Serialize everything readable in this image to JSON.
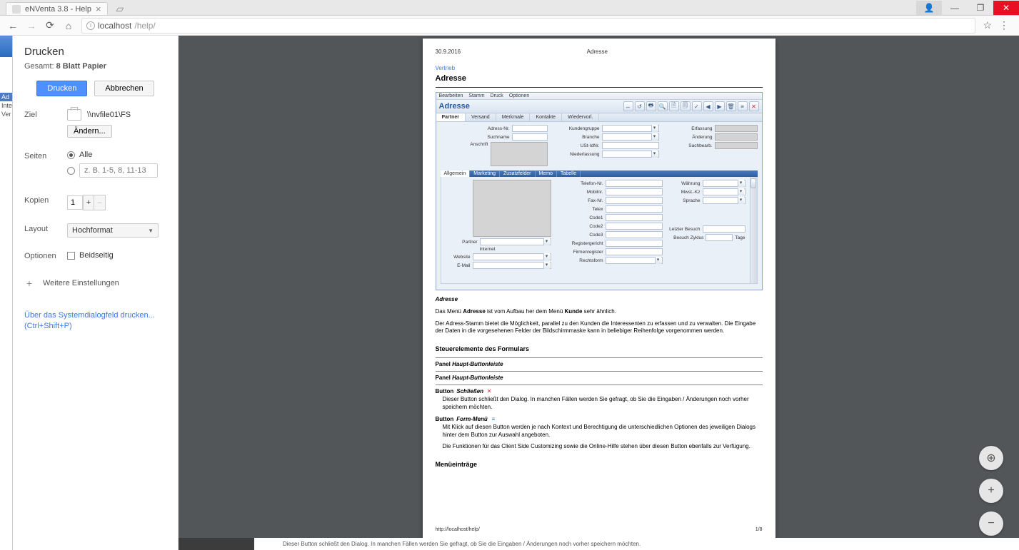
{
  "browser": {
    "tab_title": "eNVenta 3.8 - Help",
    "url_host": "localhost",
    "url_path": "/help/"
  },
  "app_sliver": {
    "chip": "Ad",
    "line1": "Inte",
    "line2": "Ver"
  },
  "print": {
    "title": "Drucken",
    "summary_prefix": "Gesamt: ",
    "summary_bold": "8 Blatt Papier",
    "btn_print": "Drucken",
    "btn_cancel": "Abbrechen",
    "dest": {
      "label": "Ziel",
      "printer": "\\\\nvfile01\\FS",
      "change": "Ändern..."
    },
    "pages": {
      "label": "Seiten",
      "all": "Alle",
      "placeholder": "z. B. 1-5, 8, 11-13"
    },
    "copies": {
      "label": "Kopien",
      "value": "1"
    },
    "layout": {
      "label": "Layout",
      "value": "Hochformat"
    },
    "options": {
      "label": "Optionen",
      "duplex": "Beidseitig"
    },
    "more": "Weitere Einstellungen",
    "syslink1": "Über das Systemdialogfeld drucken...",
    "syslink2": "(Ctrl+Shift+P)"
  },
  "doc": {
    "date": "30.9.2016",
    "header_title": "Adresse",
    "module": "Vertrieb",
    "h1": "Adresse",
    "form": {
      "menu": [
        "Bearbeiten",
        "Stamm",
        "Druck",
        "Optionen"
      ],
      "title": "Adresse",
      "toolbar_icons": [
        "↔",
        "↺",
        "🖶",
        "🔍",
        "🗎",
        "🗐",
        "✓",
        "◀",
        "▶",
        "🗑",
        "≡",
        "✕"
      ],
      "tabs": [
        "Partner",
        "Versand",
        "Merkmale",
        "Kontakte",
        "Wiedervorl."
      ],
      "top_left": [
        "Adress-Nr.",
        "Suchname",
        "Anschrift"
      ],
      "top_mid": [
        "Kundengruppe",
        "Branche",
        "USt-IdNr.",
        "Niederlassung"
      ],
      "top_right": [
        "Erfassung",
        "Änderung",
        "Sachbearb."
      ],
      "sub_tabs": [
        "Allgemein",
        "Marketing",
        "Zusatzfelder",
        "Memo",
        "Tabelle"
      ],
      "sub_left": [
        "Partner",
        "Internet",
        "Website",
        "E-Mail"
      ],
      "sub_mid": [
        "Telefon-Nr.",
        "Mobilnr.",
        "Fax-Nr.",
        "Telex",
        "Code1",
        "Code2",
        "Code3",
        "Registergericht",
        "Firmenregister",
        "Rechtsform"
      ],
      "sub_right": [
        "Währung",
        "Mwst.-Kz",
        "Sprache",
        "Letzter Besuch",
        "Besuch Zyklus"
      ],
      "tage": "Tage"
    },
    "caption": "Adresse",
    "p1a": "Das Menü ",
    "p1b": "Adresse",
    "p1c": " ist vom Aufbau her dem Menü ",
    "p1d": "Kunde",
    "p1e": " sehr ähnlich.",
    "p2": "Der Adress-Stamm bietet die Möglichkeit, parallel zu den Kunden die Interessenten zu erfassen und zu verwalten. Die Eingabe der Daten in die vorgesehenen Felder der Bildschirmmaske kann in beliebiger Reihenfolge vorgenommen werden.",
    "sect1": "Steuerelemente des Formulars",
    "panel_h": "Panel ",
    "panel_name": "Haupt-Buttonleiste",
    "btn_close_label": "Button ",
    "btn_close_name": "Schließen",
    "btn_close_desc": "Dieser Button schließt den Dialog. In manchen Fällen werden Sie gefragt, ob Sie die Eingaben / Änderungen noch vorher speichern möchten.",
    "btn_menu_label": "Button ",
    "btn_menu_name": "Form-Menü",
    "btn_menu_desc1": "Mit Klick auf diesen Button werden je nach Kontext und Berechtigung die unterschiedlichen Optionen des jeweiligen Dialogs hinter dem Button zur Auswahl angeboten.",
    "btn_menu_desc2": "Die Funktionen für das Client Side Customizing sowie die Online-Hilfe stehen über diesen Button ebenfalls zur Verfügung.",
    "sect2": "Menüeinträge",
    "footer_url": "http://localhost/help/",
    "footer_page": "1/8"
  },
  "under": "Dieser Button schließt den Dialog. In manchen Fällen werden Sie gefragt, ob Sie die Eingaben / Änderungen noch vorher speichern möchten."
}
